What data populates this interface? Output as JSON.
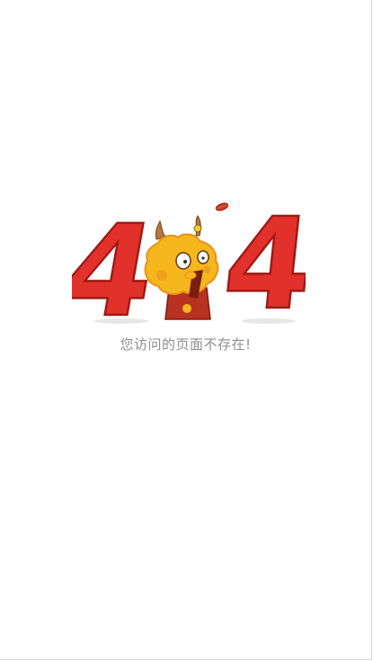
{
  "error_page": {
    "code_left_digit": "4",
    "code_right_digit": "4",
    "mascot": "dragon-mascot-icon",
    "message": "您访问的页面不存在!",
    "colors": {
      "digit_red": "#e2302a",
      "digit_outline": "#9e1b17",
      "mascot_yellow": "#f6b61e",
      "mascot_orange": "#e8921a",
      "shirt_red": "#b8321f",
      "shadow_gray": "#e6e6e6",
      "message_gray": "#8e8e8e"
    }
  }
}
